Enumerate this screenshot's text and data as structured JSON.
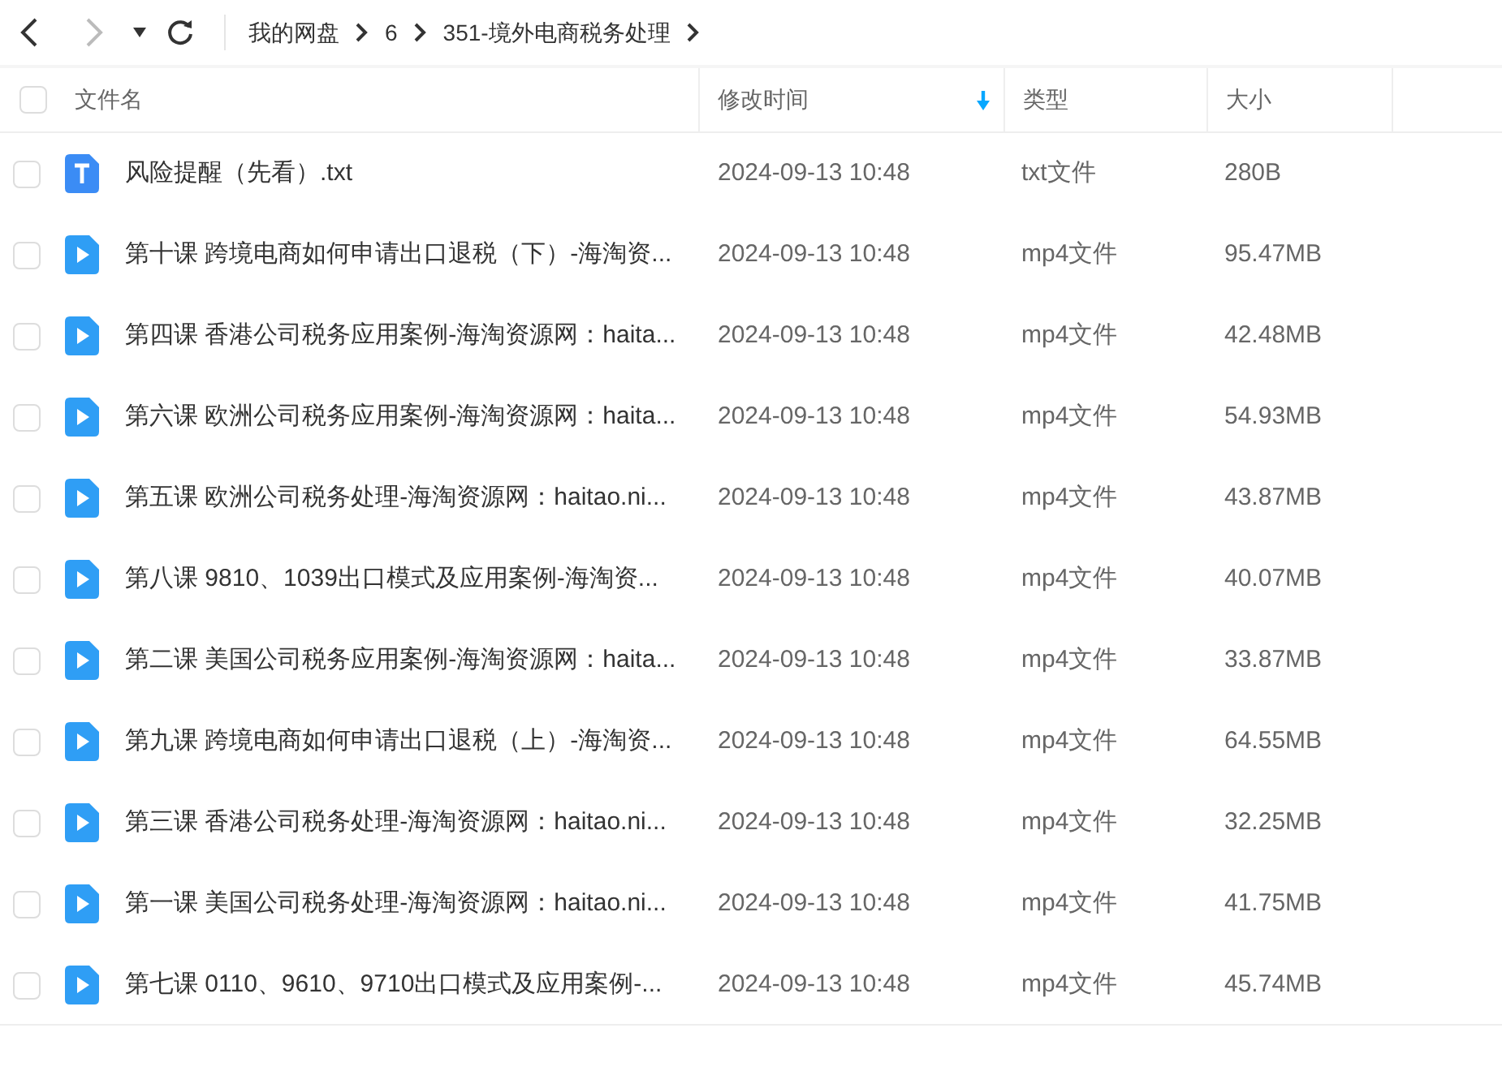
{
  "toolbar": {
    "breadcrumbs": [
      "我的网盘",
      "6",
      "351-境外电商税务处理"
    ]
  },
  "table": {
    "columns": [
      {
        "label": "文件名"
      },
      {
        "label": "修改时间",
        "sorted": true
      },
      {
        "label": "类型"
      },
      {
        "label": "大小"
      }
    ],
    "select_all": {
      "checked": false
    },
    "rows": [
      {
        "kind": "text",
        "name": "风险提醒（先看）.txt",
        "modified": "2024-09-13 10:48",
        "type": "txt文件",
        "size": "280B",
        "checked": false
      },
      {
        "kind": "video",
        "name": "第十课 跨境电商如何申请出口退税（下）-海淘资...",
        "modified": "2024-09-13 10:48",
        "type": "mp4文件",
        "size": "95.47MB",
        "checked": false
      },
      {
        "kind": "video",
        "name": "第四课 香港公司税务应用案例-海淘资源网：haita...",
        "modified": "2024-09-13 10:48",
        "type": "mp4文件",
        "size": "42.48MB",
        "checked": false
      },
      {
        "kind": "video",
        "name": "第六课 欧洲公司税务应用案例-海淘资源网：haita...",
        "modified": "2024-09-13 10:48",
        "type": "mp4文件",
        "size": "54.93MB",
        "checked": false
      },
      {
        "kind": "video",
        "name": "第五课 欧洲公司税务处理-海淘资源网：haitao.ni...",
        "modified": "2024-09-13 10:48",
        "type": "mp4文件",
        "size": "43.87MB",
        "checked": false
      },
      {
        "kind": "video",
        "name": "第八课 9810、1039出口模式及应用案例-海淘资...",
        "modified": "2024-09-13 10:48",
        "type": "mp4文件",
        "size": "40.07MB",
        "checked": false
      },
      {
        "kind": "video",
        "name": "第二课 美国公司税务应用案例-海淘资源网：haita...",
        "modified": "2024-09-13 10:48",
        "type": "mp4文件",
        "size": "33.87MB",
        "checked": false
      },
      {
        "kind": "video",
        "name": "第九课 跨境电商如何申请出口退税（上）-海淘资...",
        "modified": "2024-09-13 10:48",
        "type": "mp4文件",
        "size": "64.55MB",
        "checked": false
      },
      {
        "kind": "video",
        "name": "第三课 香港公司税务处理-海淘资源网：haitao.ni...",
        "modified": "2024-09-13 10:48",
        "type": "mp4文件",
        "size": "32.25MB",
        "checked": false
      },
      {
        "kind": "video",
        "name": "第一课 美国公司税务处理-海淘资源网：haitao.ni...",
        "modified": "2024-09-13 10:48",
        "type": "mp4文件",
        "size": "41.75MB",
        "checked": false
      },
      {
        "kind": "video",
        "name": "第七课 0110、9610、9710出口模式及应用案例-...",
        "modified": "2024-09-13 10:48",
        "type": "mp4文件",
        "size": "45.74MB",
        "checked": false
      }
    ]
  }
}
